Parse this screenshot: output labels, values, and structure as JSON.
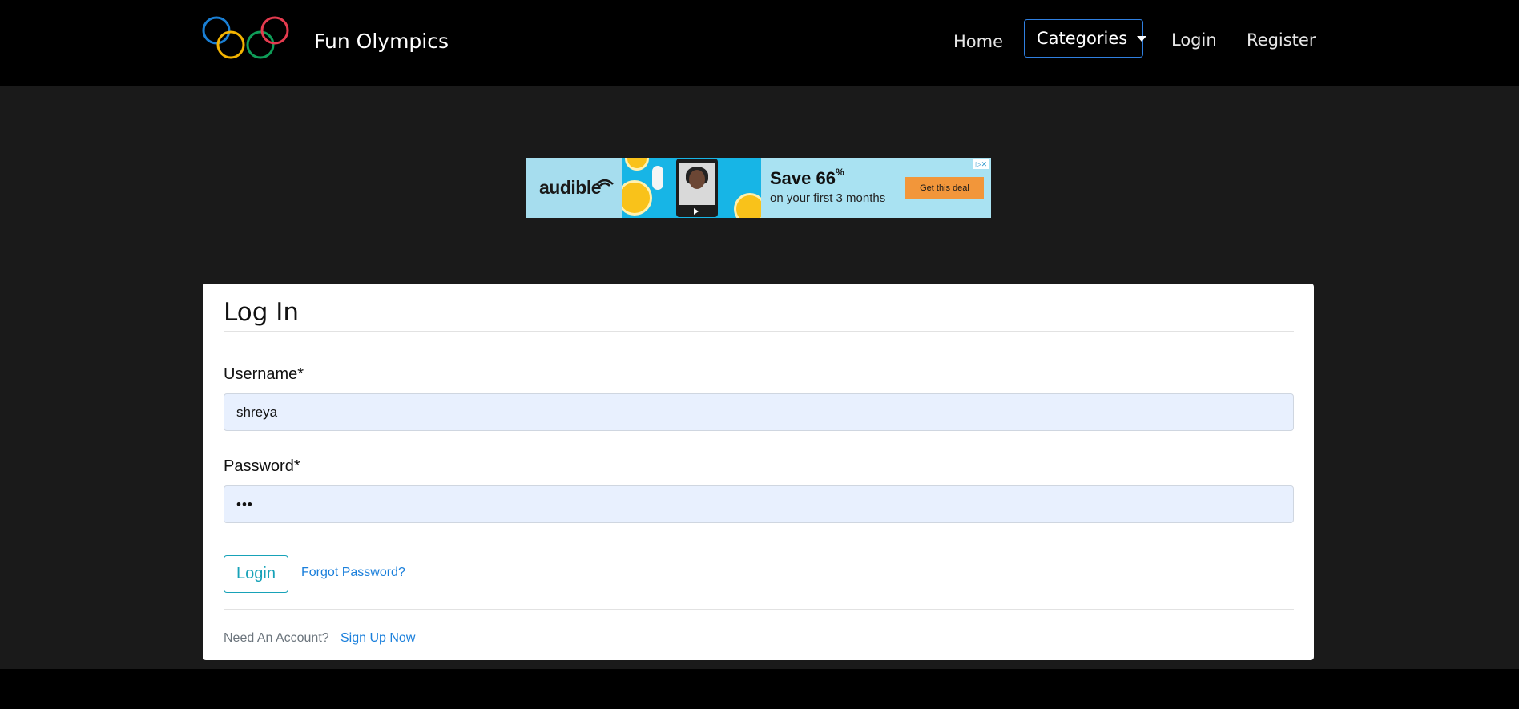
{
  "navbar": {
    "brand": "Fun Olympics",
    "links": {
      "home": "Home",
      "categories": "Categories",
      "login": "Login",
      "register": "Register"
    },
    "logo_colors": [
      "#1a7fd4",
      "#f4b400",
      "#1a1a1a",
      "#0f9d58",
      "#e53b4f"
    ]
  },
  "ad": {
    "brand": "audible",
    "headline": "Save 66",
    "headline_sup": "%",
    "subline": "on your first 3 months",
    "cta": "Get this deal"
  },
  "login_card": {
    "title": "Log In",
    "username_label": "Username*",
    "username_value": "shreya",
    "password_label": "Password*",
    "password_value": "•••",
    "login_button": "Login",
    "forgot_link": "Forgot Password?",
    "need_account": "Need An Account?",
    "signup_link": "Sign Up Now"
  },
  "colors": {
    "navbar_bg": "#000000",
    "page_bg": "#1a1a1a",
    "accent_teal": "#17a2b8",
    "link_blue": "#1a7fdb",
    "dropdown_border": "#2f7fe0"
  }
}
